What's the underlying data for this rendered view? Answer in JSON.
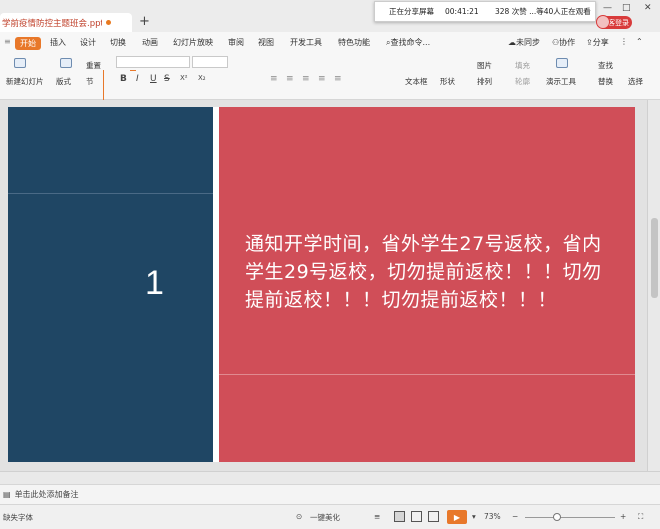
{
  "tabbar": {
    "doc_title": "学前疫情防控主题班会.pptx",
    "new_tab_symbol": "+",
    "share_banner": {
      "status": "正在分享屏幕",
      "time": "00:41:21",
      "stats": "328 次赞 ...等40人正在观看"
    },
    "login_label": "访客登录",
    "window_controls": [
      "—",
      "□",
      "✕"
    ],
    "win_icons": [
      "▭",
      "⊡",
      "✕"
    ]
  },
  "menu": {
    "start": "开始",
    "items": [
      "插入",
      "设计",
      "切换",
      "动画",
      "幻灯片放映",
      "审阅",
      "视图",
      "开发工具",
      "特色功能"
    ],
    "search": "查找命令...",
    "right_items": [
      "未同步",
      "协作",
      "分享"
    ]
  },
  "ribbon": {
    "new_slide": "新建幻灯片",
    "layout": "版式",
    "reset": "重置",
    "section": "节",
    "text_box": "文本框",
    "shape": "形状",
    "arrange": "排列",
    "picture": "图片",
    "fill": "填充",
    "outline": "轮廓",
    "slideshow_tool": "演示工具",
    "find": "查找",
    "replace": "替换",
    "select": "选择",
    "format_buttons": [
      "B",
      "I",
      "U",
      "S",
      "X²",
      "X₂"
    ]
  },
  "slide": {
    "number": "1",
    "notice": "通知开学时间，省外学生27号返校，省内学生29号返校，切勿提前返校！！！切勿提前返校！！！切勿提前返校！！！",
    "colors": {
      "left_panel": "#1f4664",
      "right_panel": "#d04e58"
    }
  },
  "notes": {
    "placeholder": "单击此处添加备注"
  },
  "status": {
    "font_missing": "缺失字体",
    "beautify": "一键美化",
    "zoom": "73%",
    "zoom_value": 0.73
  }
}
